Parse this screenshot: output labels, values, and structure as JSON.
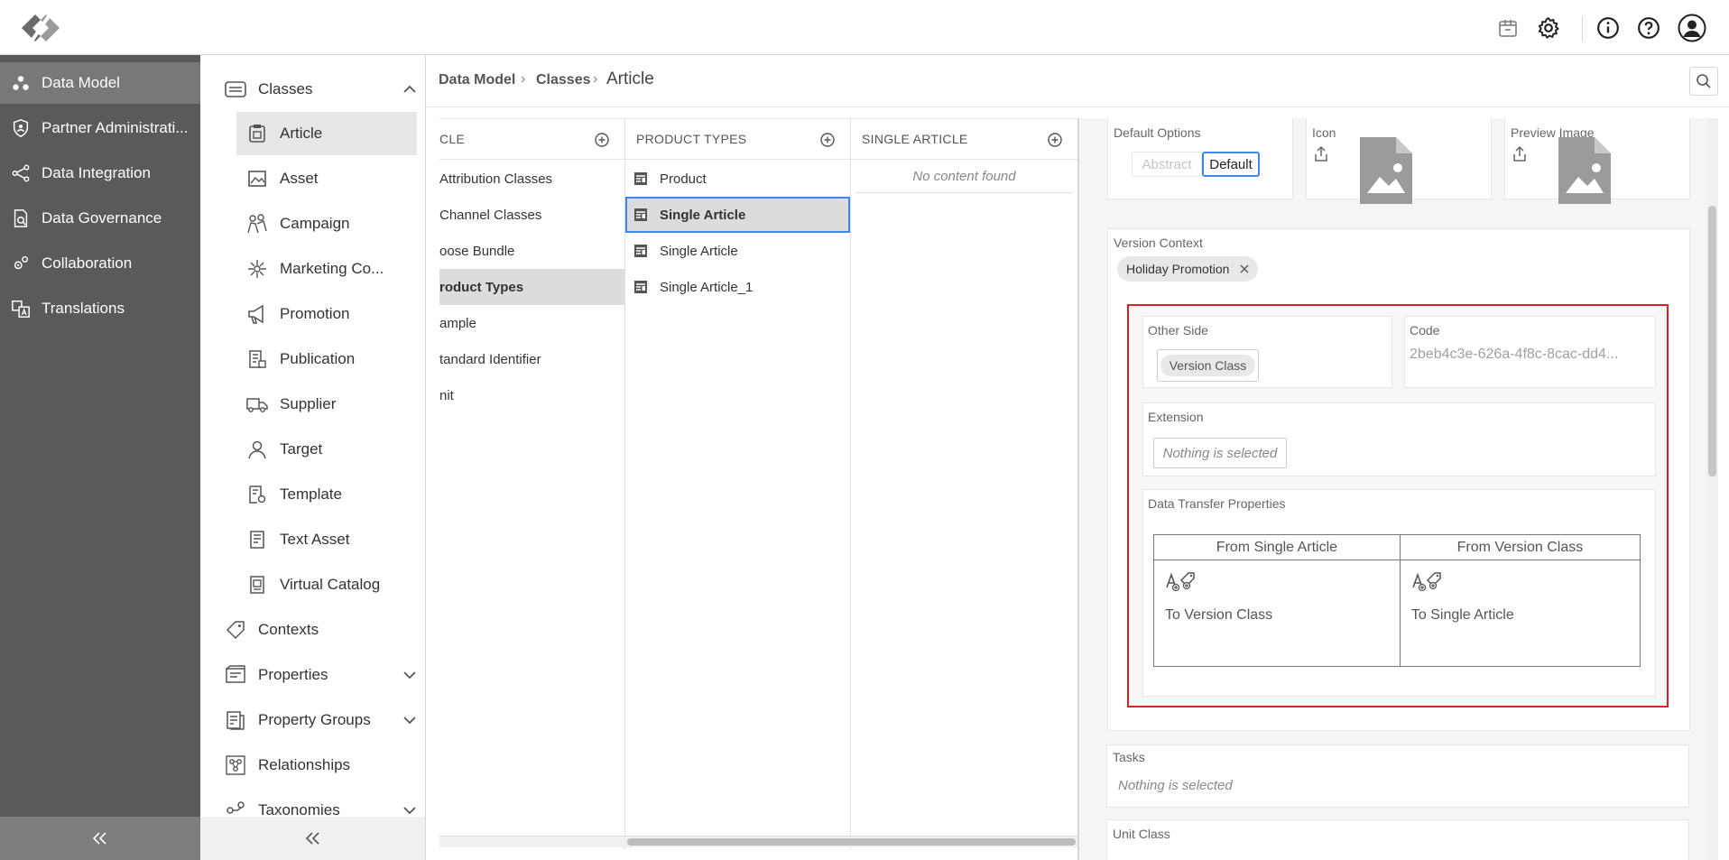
{
  "topbar": {
    "icons": [
      "package-icon",
      "gear-icon",
      "info-icon",
      "help-icon",
      "user-avatar-icon"
    ]
  },
  "nav": {
    "items": [
      {
        "label": "Data Model",
        "icon": "data-model-icon",
        "active": true
      },
      {
        "label": "Partner Administrati...",
        "icon": "shield-icon"
      },
      {
        "label": "Data Integration",
        "icon": "integration-icon"
      },
      {
        "label": "Data Governance",
        "icon": "governance-icon"
      },
      {
        "label": "Collaboration",
        "icon": "collaboration-icon"
      },
      {
        "label": "Translations",
        "icon": "translations-icon"
      }
    ]
  },
  "sub": {
    "classes_label": "Classes",
    "items": [
      {
        "label": "Article",
        "icon": "article-icon",
        "selected": true
      },
      {
        "label": "Asset",
        "icon": "asset-icon"
      },
      {
        "label": "Campaign",
        "icon": "campaign-icon"
      },
      {
        "label": "Marketing Co...",
        "icon": "marketing-icon"
      },
      {
        "label": "Promotion",
        "icon": "megaphone-icon"
      },
      {
        "label": "Publication",
        "icon": "publication-icon"
      },
      {
        "label": "Supplier",
        "icon": "truck-icon"
      },
      {
        "label": "Target",
        "icon": "target-icon"
      },
      {
        "label": "Template",
        "icon": "template-icon"
      },
      {
        "label": "Text Asset",
        "icon": "text-asset-icon"
      },
      {
        "label": "Virtual Catalog",
        "icon": "catalog-icon"
      }
    ],
    "contexts_label": "Contexts",
    "properties_label": "Properties",
    "property_groups_label": "Property Groups",
    "relationships_label": "Relationships",
    "taxonomies_label": "Taxonomies"
  },
  "breadcrumb": {
    "c1": "Data Model",
    "c2": "Classes",
    "c3": "Article",
    "sep": "›"
  },
  "columns": {
    "col1": {
      "title": "CLE",
      "rows": [
        "Attribution Classes",
        "Channel Classes",
        "oose Bundle",
        "roduct Types",
        "ample",
        "tandard Identifier",
        "nit"
      ]
    },
    "col2": {
      "title": "PRODUCT TYPES",
      "rows": [
        "Product",
        "Single Article",
        "Single Article",
        "Single Article_1"
      ]
    },
    "col3": {
      "title": "SINGLE ARTICLE",
      "empty": "No content found"
    }
  },
  "detail": {
    "default_options": {
      "label": "Default Options",
      "abstract": "Abstract",
      "default": "Default"
    },
    "icon_label": "Icon",
    "preview_label": "Preview Image",
    "version_context": {
      "label": "Version Context",
      "chip": "Holiday Promotion"
    },
    "other_side": {
      "label": "Other Side",
      "chip": "Version Class"
    },
    "code": {
      "label": "Code",
      "value": "2beb4c3e-626a-4f8c-8cac-dd4..."
    },
    "extension": {
      "label": "Extension",
      "value": "Nothing is selected"
    },
    "dtp": {
      "label": "Data Transfer Properties",
      "h1": "From Single Article",
      "h2": "From Version Class",
      "c1": "To Version Class",
      "c2": "To Single Article"
    },
    "tasks": {
      "label": "Tasks",
      "value": "Nothing is selected"
    },
    "unit_class": {
      "label": "Unit Class"
    }
  },
  "colors": {
    "accent": "#3f86f0",
    "highlight": "#e21f26",
    "nav_bg": "#5a5a5a"
  }
}
